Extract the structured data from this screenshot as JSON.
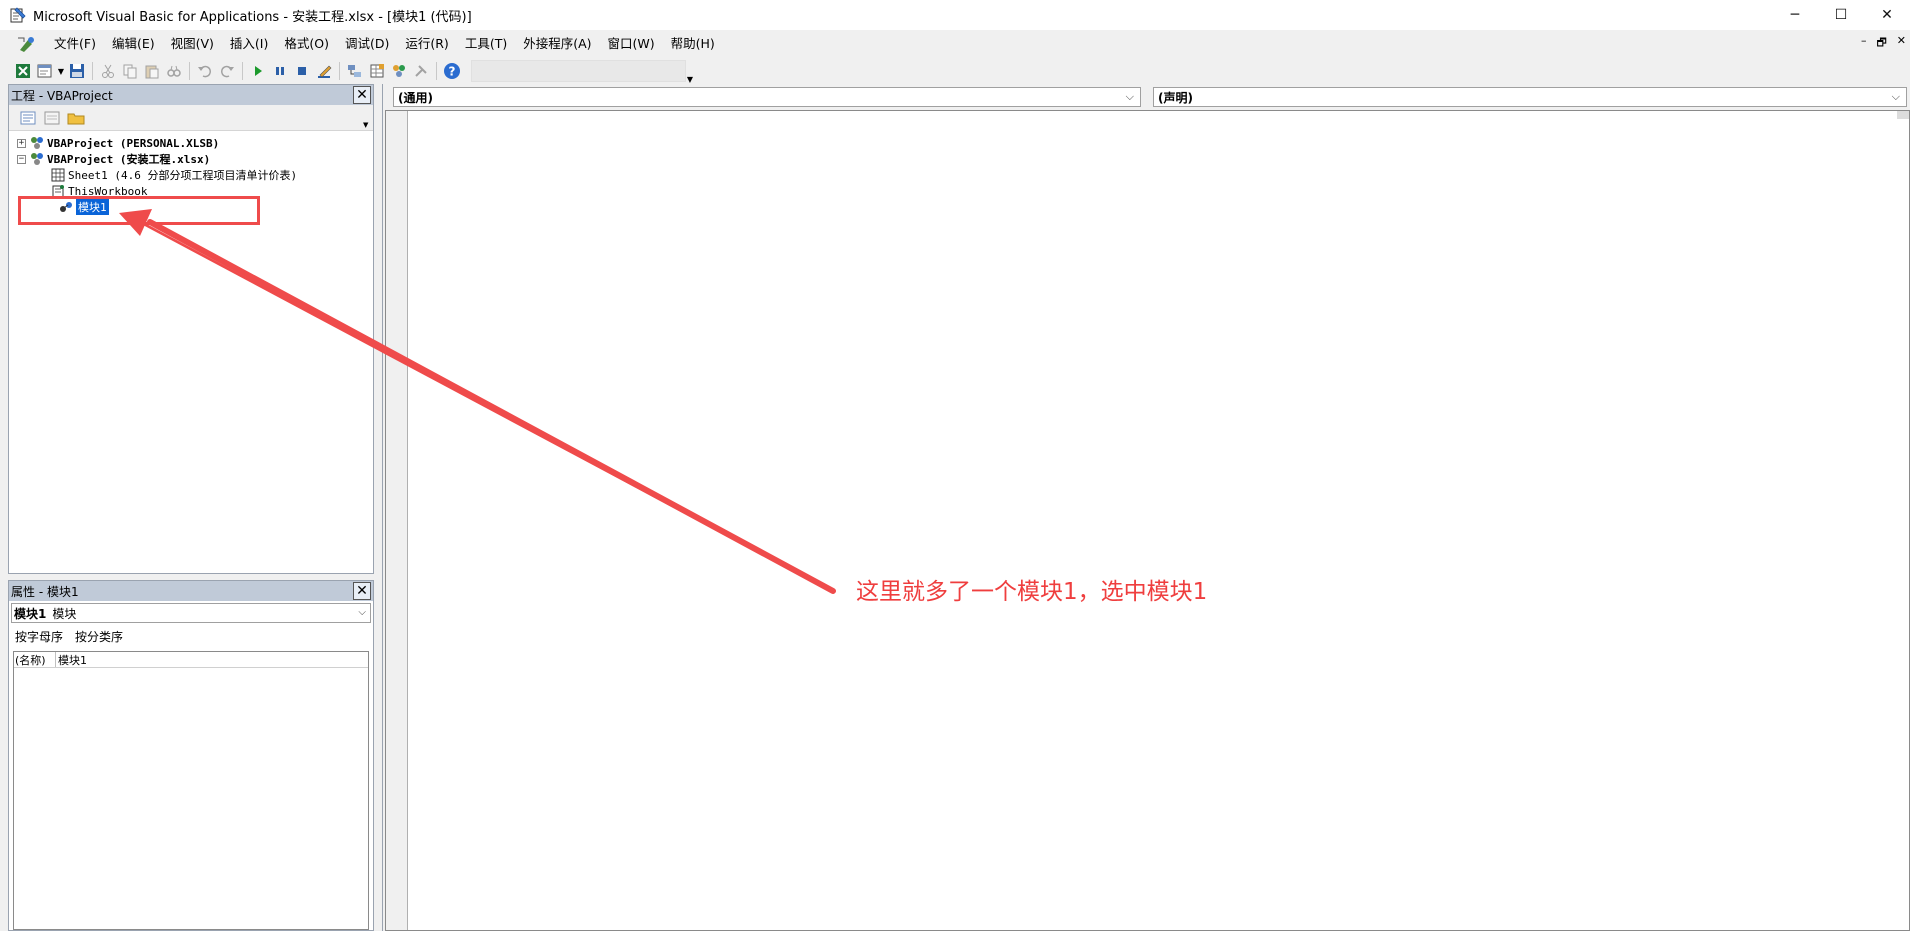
{
  "window": {
    "title": "Microsoft Visual Basic for Applications - 安装工程.xlsx - [模块1 (代码)]",
    "minimize_glyph": "─",
    "maximize_glyph": "☐",
    "close_glyph": "✕"
  },
  "menu": {
    "items": [
      "文件(F)",
      "编辑(E)",
      "视图(V)",
      "插入(I)",
      "格式(O)",
      "调试(D)",
      "运行(R)",
      "工具(T)",
      "外接程序(A)",
      "窗口(W)",
      "帮助(H)"
    ],
    "mdi_minimize": "–",
    "mdi_restore": "🗗",
    "mdi_close": "✕"
  },
  "toolbar": {
    "icons": [
      "excel-icon",
      "insert-userform-icon",
      "save-icon",
      "cut-icon",
      "copy-icon",
      "paste-icon",
      "find-icon",
      "undo-icon",
      "redo-icon",
      "run-icon",
      "break-icon",
      "reset-icon",
      "design-mode-icon",
      "project-explorer-icon",
      "properties-icon",
      "object-browser-icon",
      "toolbox-icon",
      "help-icon"
    ]
  },
  "project_panel": {
    "title": "工程 - VBAProject",
    "close_glyph": "✕",
    "tree": [
      {
        "label": "VBAProject (PERSONAL.XLSB)",
        "expander": "+",
        "bold": true
      },
      {
        "label": "VBAProject (安装工程.xlsx)",
        "expander": "−",
        "bold": true
      },
      {
        "label": "Sheet1 (4.6 分部分项工程项目清单计价表)"
      },
      {
        "label": "ThisWorkbook"
      },
      {
        "label": "模块1",
        "selected": true
      }
    ]
  },
  "properties_panel": {
    "title": "属性 - 模块1",
    "close_glyph": "✕",
    "object_name": "模块1",
    "object_type": "模块",
    "tabs": [
      "按字母序",
      "按分类序"
    ],
    "rows": [
      {
        "key": "(名称)",
        "value": "模块1"
      }
    ]
  },
  "code_window": {
    "object_combo": "(通用)",
    "procedure_combo": "(声明)"
  },
  "annotation": {
    "text": "这里就多了一个模块1，选中模块1",
    "color": "#ef3e3e"
  }
}
